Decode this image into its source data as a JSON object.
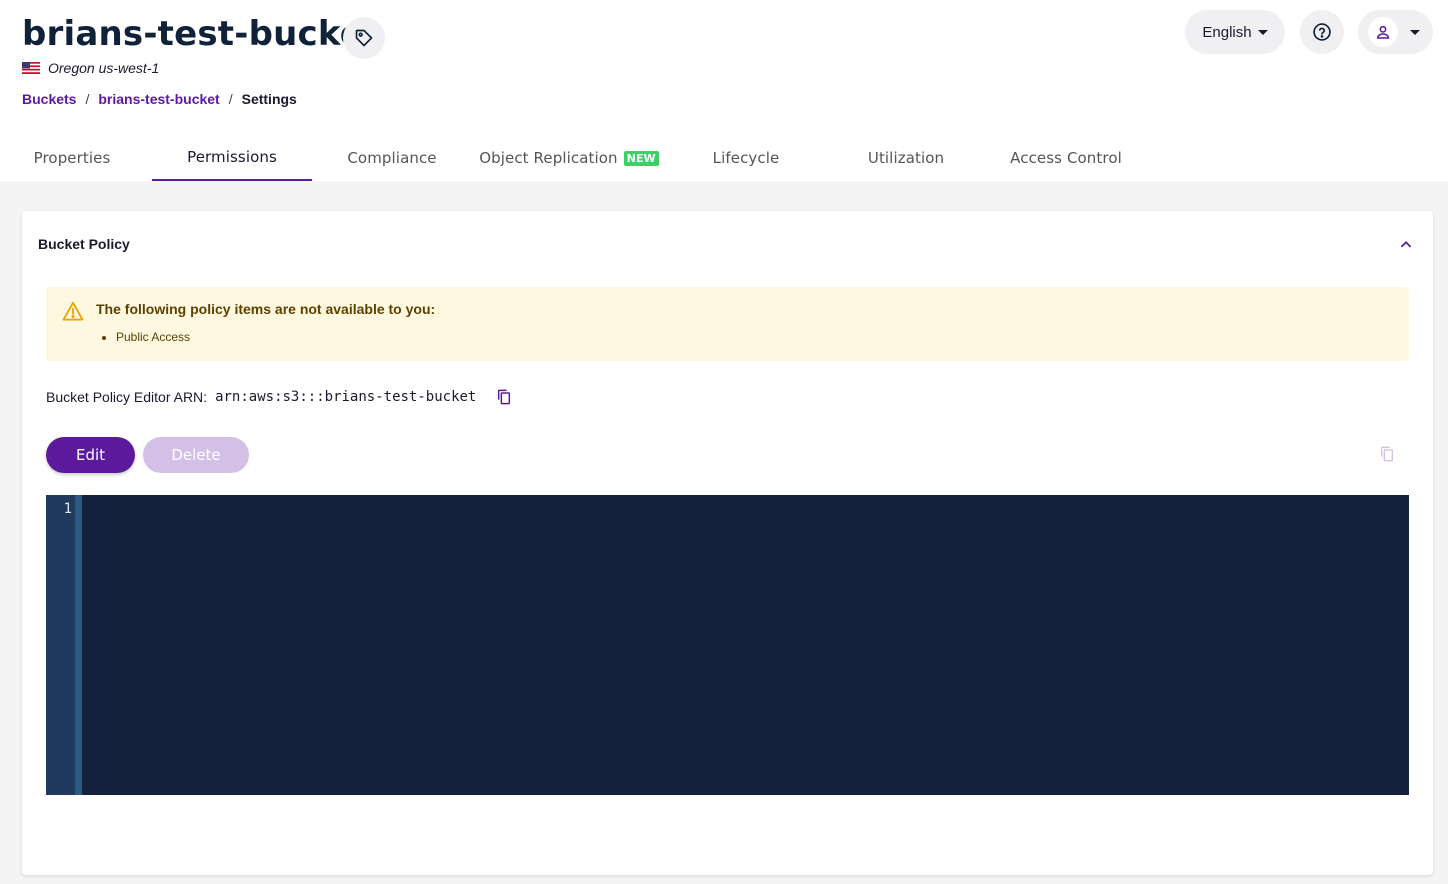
{
  "header": {
    "title": "brians-test-bucket",
    "region": "Oregon us-west-1",
    "breadcrumb": {
      "root": "Buckets",
      "bucket": "brians-test-bucket",
      "current": "Settings",
      "separator": "/"
    },
    "language": "English"
  },
  "tabs": [
    {
      "label": "Properties"
    },
    {
      "label": "Permissions"
    },
    {
      "label": "Compliance"
    },
    {
      "label": "Object Replication",
      "badge": "NEW"
    },
    {
      "label": "Lifecycle"
    },
    {
      "label": "Utilization"
    },
    {
      "label": "Access Control"
    }
  ],
  "active_tab": "Permissions",
  "bucket_policy": {
    "title": "Bucket Policy",
    "warning": {
      "title": "The following policy items are not available to you:",
      "items": [
        "Public Access"
      ]
    },
    "arn_label": "Bucket Policy Editor ARN:",
    "arn_value": "arn:aws:s3:::brians-test-bucket",
    "edit_label": "Edit",
    "delete_label": "Delete",
    "editor": {
      "line_numbers": [
        "1"
      ]
    }
  },
  "colors": {
    "accent": "#5b1a9c",
    "editor_bg": "#13213a",
    "warning_bg": "#fff8e1",
    "new_badge": "#3ecf68"
  }
}
